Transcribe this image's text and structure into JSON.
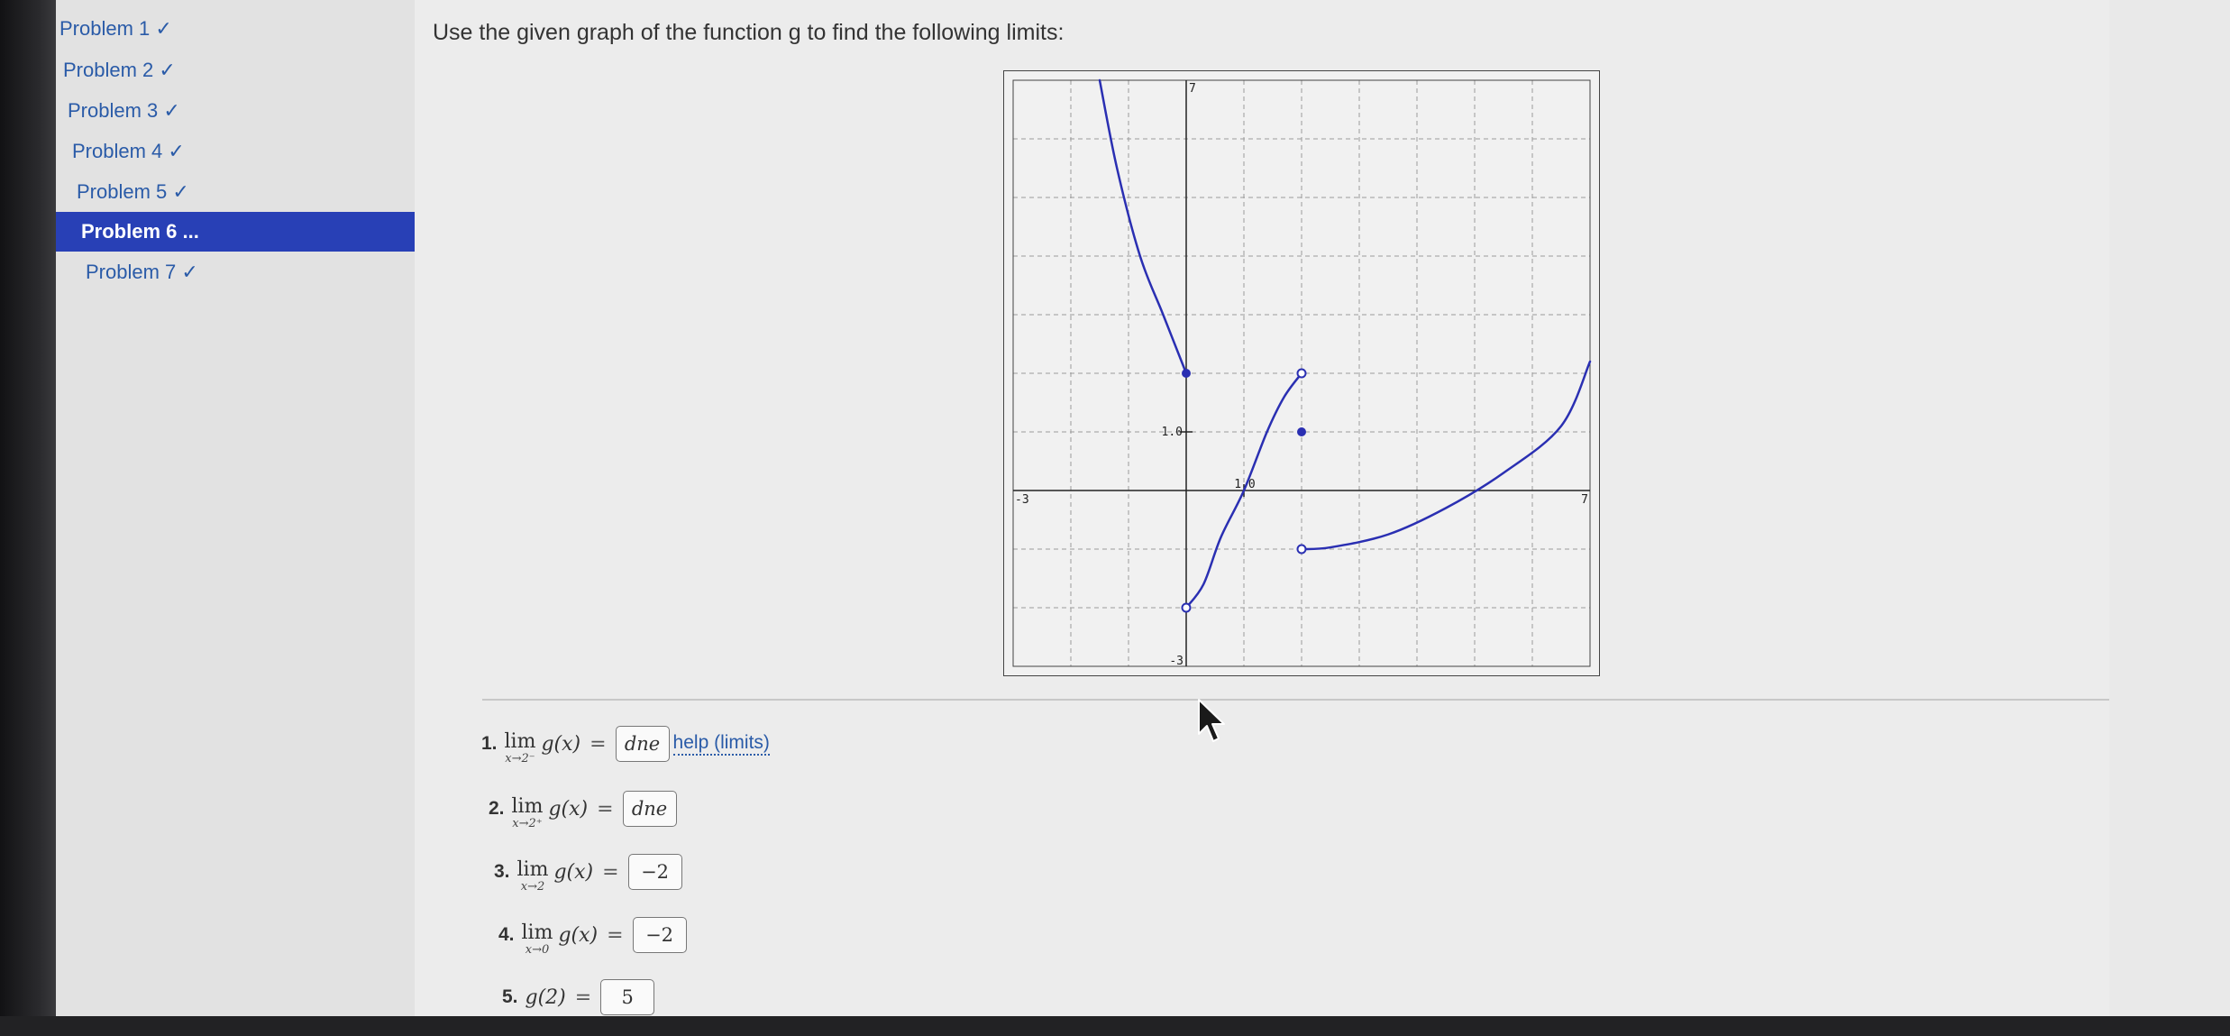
{
  "sidebar": {
    "items": [
      {
        "label": "Problem 1 ✓",
        "active": false
      },
      {
        "label": "Problem 2 ✓",
        "active": false
      },
      {
        "label": "Problem 3 ✓",
        "active": false
      },
      {
        "label": "Problem 4 ✓",
        "active": false
      },
      {
        "label": "Problem 5 ✓",
        "active": false
      },
      {
        "label": "Problem 6 ...",
        "active": true
      },
      {
        "label": "Problem 7 ✓",
        "active": false
      }
    ]
  },
  "problem": {
    "statement": "Use the given graph of the function g to find the following limits:",
    "function_name": "g"
  },
  "graph": {
    "x_range": [
      -3,
      7
    ],
    "y_range": [
      -3,
      7
    ],
    "tick_labels": {
      "x_min": "-3",
      "x_max": "7",
      "y_min": "-3",
      "y_max": "7",
      "x_unit": "1.0",
      "y_unit": "1.0"
    },
    "grid": true,
    "curve_color": "#2a2fb2",
    "curves": [
      {
        "name": "left-branch",
        "points": [
          [
            -1.5,
            7.0
          ],
          [
            -1.2,
            5.5
          ],
          [
            -0.8,
            4.0
          ],
          [
            -0.4,
            3.0
          ],
          [
            0,
            2.0
          ]
        ]
      },
      {
        "name": "middle-branch",
        "points": [
          [
            0,
            -2.0
          ],
          [
            0.3,
            -1.6
          ],
          [
            0.6,
            -0.8
          ],
          [
            1.0,
            0.0
          ],
          [
            1.4,
            1.0
          ],
          [
            1.7,
            1.6
          ],
          [
            2.0,
            2.0
          ]
        ]
      },
      {
        "name": "right-branch",
        "points": [
          [
            2.0,
            -1.0
          ],
          [
            2.5,
            -0.97
          ],
          [
            3.5,
            -0.75
          ],
          [
            4.5,
            -0.3
          ],
          [
            5.5,
            0.3
          ],
          [
            6.5,
            1.1
          ],
          [
            7.0,
            2.2
          ]
        ]
      }
    ],
    "closed_points": [
      [
        0,
        2
      ],
      [
        2,
        1
      ]
    ],
    "open_points": [
      [
        0,
        -2
      ],
      [
        2,
        2
      ],
      [
        2,
        -1
      ]
    ]
  },
  "answers": [
    {
      "num": "1.",
      "lim": "lim",
      "approach": "x→2⁻",
      "expr": "g(x)",
      "eq": "=",
      "value": "dne"
    },
    {
      "num": "2.",
      "lim": "lim",
      "approach": "x→2⁺",
      "expr": "g(x)",
      "eq": "=",
      "value": "dne"
    },
    {
      "num": "3.",
      "lim": "lim",
      "approach": "x→2",
      "expr": "g(x)",
      "eq": "=",
      "value": "−2"
    },
    {
      "num": "4.",
      "lim": "lim",
      "approach": "x→0",
      "expr": "g(x)",
      "eq": "=",
      "value": "−2"
    },
    {
      "num": "5.",
      "expr": "g(2)",
      "eq": "=",
      "value": "5"
    }
  ],
  "help_link": "help (limits)"
}
